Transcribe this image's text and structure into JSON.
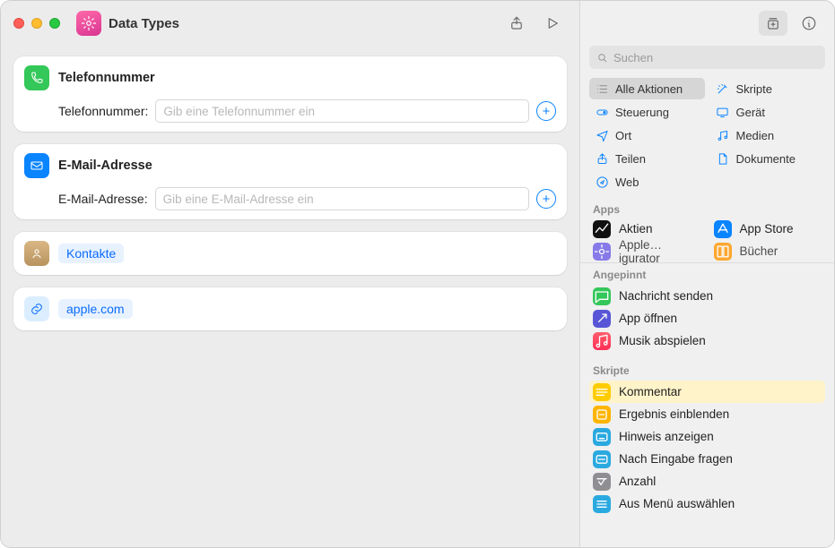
{
  "window": {
    "title": "Data Types"
  },
  "actions": {
    "phone": {
      "title": "Telefonnummer",
      "param_label": "Telefonnummer:",
      "placeholder": "Gib eine Telefonnummer ein"
    },
    "email": {
      "title": "E-Mail-Adresse",
      "param_label": "E-Mail-Adresse:",
      "placeholder": "Gib eine E-Mail-Adresse ein"
    },
    "contacts_token": "Kontakte",
    "url_token": "apple.com"
  },
  "sidebar": {
    "search_placeholder": "Suchen",
    "categories": {
      "all": "Alle Aktionen",
      "scripts": "Skripte",
      "control": "Steuerung",
      "device": "Gerät",
      "location": "Ort",
      "media": "Medien",
      "share": "Teilen",
      "documents": "Dokumente",
      "web": "Web"
    },
    "apps_header": "Apps",
    "apps": {
      "aktien": "Aktien",
      "appstore": "App Store",
      "apple": "Apple…igurator",
      "bucher": "Bücher"
    },
    "pinned_header": "Angepinnt",
    "pinned": {
      "message": "Nachricht senden",
      "openapp": "App öffnen",
      "music": "Musik abspielen"
    },
    "scripts_header": "Skripte",
    "scripts": {
      "comment": "Kommentar",
      "result": "Ergebnis einblenden",
      "alert": "Hinweis anzeigen",
      "ask": "Nach Eingabe fragen",
      "count": "Anzahl",
      "menu": "Aus Menü auswählen"
    }
  }
}
